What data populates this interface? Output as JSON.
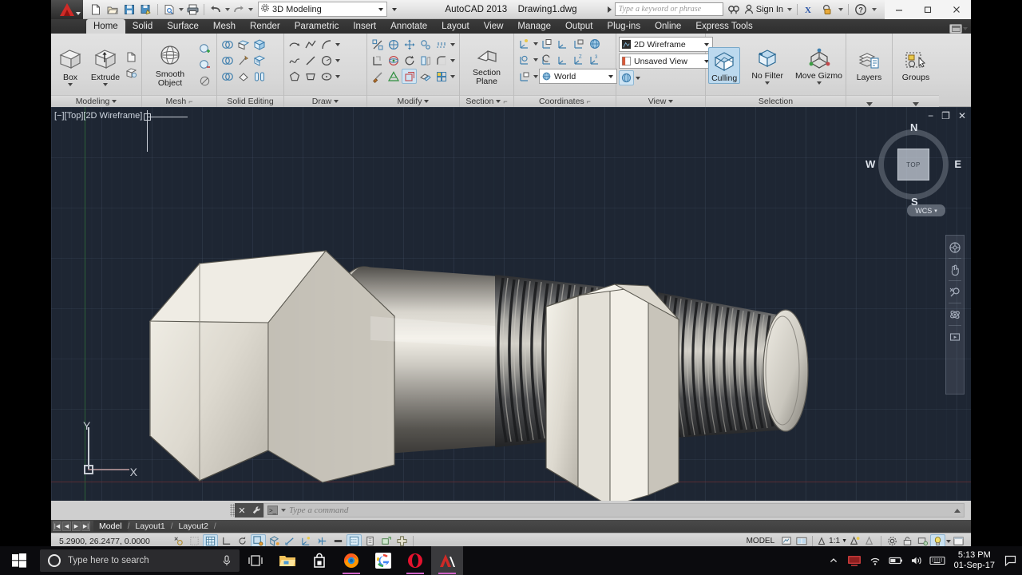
{
  "window": {
    "app_name": "AutoCAD 2013",
    "document_name": "Drawing1.dwg",
    "workspace": "3D Modeling",
    "sign_in": "Sign In",
    "minimize": "–",
    "restore": "❐",
    "close": "✕"
  },
  "search": {
    "placeholder": "Type a keyword or phrase"
  },
  "quick_access": [
    {
      "name": "new-icon",
      "tooltip": "New"
    },
    {
      "name": "open-icon",
      "tooltip": "Open"
    },
    {
      "name": "save-icon",
      "tooltip": "Save"
    },
    {
      "name": "save-as-icon",
      "tooltip": "Save As"
    },
    {
      "name": "plot-preview-icon",
      "tooltip": "Plot Preview"
    },
    {
      "name": "plot-icon",
      "tooltip": "Plot"
    },
    {
      "name": "undo-icon",
      "tooltip": "Undo"
    },
    {
      "name": "redo-icon",
      "tooltip": "Redo"
    }
  ],
  "ribbon": {
    "tabs": [
      {
        "label": "Home",
        "active": true
      },
      {
        "label": "Solid",
        "active": false
      },
      {
        "label": "Surface",
        "active": false
      },
      {
        "label": "Mesh",
        "active": false
      },
      {
        "label": "Render",
        "active": false
      },
      {
        "label": "Parametric",
        "active": false
      },
      {
        "label": "Insert",
        "active": false
      },
      {
        "label": "Annotate",
        "active": false
      },
      {
        "label": "Layout",
        "active": false
      },
      {
        "label": "View",
        "active": false
      },
      {
        "label": "Manage",
        "active": false
      },
      {
        "label": "Output",
        "active": false
      },
      {
        "label": "Plug-ins",
        "active": false
      },
      {
        "label": "Online",
        "active": false
      },
      {
        "label": "Express Tools",
        "active": false
      }
    ],
    "panels": {
      "modeling": {
        "title": "Modeling",
        "box_label": "Box",
        "extrude_label": "Extrude"
      },
      "mesh": {
        "title": "Mesh",
        "smooth_object_label": "Smooth Object"
      },
      "solid_editing": {
        "title": "Solid Editing"
      },
      "draw": {
        "title": "Draw"
      },
      "modify": {
        "title": "Modify"
      },
      "section": {
        "title": "Section",
        "section_plane_label": "Section Plane"
      },
      "coordinates": {
        "title": "Coordinates",
        "ucs_value": "World"
      },
      "view": {
        "title": "View",
        "visual_style": "2D Wireframe",
        "named_view": "Unsaved View"
      },
      "selection": {
        "title": "Selection",
        "culling_label": "Culling",
        "filter_label": "No Filter",
        "gizmo_label": "Move Gizmo"
      },
      "layers": {
        "title": "Layers",
        "label": "Layers"
      },
      "groups": {
        "title": "Groups",
        "label": "Groups"
      }
    }
  },
  "viewport": {
    "label": "[−][Top][2D Wireframe]",
    "viewcube": {
      "face": "TOP",
      "north": "N",
      "south": "S",
      "east": "E",
      "west": "W",
      "ucs_label": "WCS"
    },
    "ucs_icon": {
      "x_label": "X",
      "y_label": "Y"
    },
    "background_color": "#1e2633",
    "navbar_tools": [
      "steering-wheel-icon",
      "pan-icon",
      "zoom-icon",
      "orbit-icon",
      "showmotion-icon"
    ],
    "window_buttons": {
      "minimize": "−",
      "maximize": "❐",
      "close": "✕"
    }
  },
  "command_line": {
    "placeholder": "Type a command",
    "close_label": "✕"
  },
  "layout_tabs": [
    {
      "label": "Model",
      "active": true
    },
    {
      "label": "Layout1",
      "active": false
    },
    {
      "label": "Layout2",
      "active": false
    }
  ],
  "status_bar": {
    "coordinates": "5.2900, 26.2477, 0.0000",
    "space_label": "MODEL",
    "annotation_scale": "1:1",
    "toggles": [
      {
        "name": "snap-mode-toggle",
        "on": false
      },
      {
        "name": "grid-display-toggle",
        "on": false
      },
      {
        "name": "grid-snap-toggle",
        "on": true
      },
      {
        "name": "ortho-mode-toggle",
        "on": false
      },
      {
        "name": "polar-tracking-toggle",
        "on": false
      },
      {
        "name": "object-snap-toggle",
        "on": true
      },
      {
        "name": "3d-object-snap-toggle",
        "on": false
      },
      {
        "name": "object-snap-tracking-toggle",
        "on": false
      },
      {
        "name": "dynamic-ucs-toggle",
        "on": false
      },
      {
        "name": "dynamic-input-toggle",
        "on": false
      },
      {
        "name": "lineweight-toggle",
        "on": false
      },
      {
        "name": "transparency-toggle",
        "on": true
      },
      {
        "name": "selection-cycling-toggle",
        "on": false
      },
      {
        "name": "annotation-monitor-toggle",
        "on": false
      },
      {
        "name": "add-button",
        "on": false
      }
    ]
  },
  "taskbar": {
    "search_placeholder": "Type here to search",
    "apps": [
      {
        "name": "task-view-icon",
        "label": "Task View"
      },
      {
        "name": "file-explorer-icon",
        "label": "File Explorer"
      },
      {
        "name": "microsoft-store-icon",
        "label": "Microsoft Store"
      },
      {
        "name": "firefox-icon",
        "label": "Mozilla Firefox"
      },
      {
        "name": "google-chrome-icon",
        "label": "Google"
      },
      {
        "name": "opera-icon",
        "label": "Opera"
      },
      {
        "name": "autocad-icon",
        "label": "AutoCAD 2013"
      }
    ],
    "tray": [
      "show-hidden-icons",
      "security-icon",
      "wifi-icon",
      "battery-icon",
      "volume-icon",
      "keyboard-icon"
    ],
    "time": "5:13 PM",
    "date": "01-Sep-17"
  },
  "model": {
    "description": "3D bolt and nut assembly rendered in conceptual/realistic style",
    "metal_light": "#e3e0d8",
    "metal_mid": "#9a968f",
    "metal_dark": "#2c2d30"
  }
}
